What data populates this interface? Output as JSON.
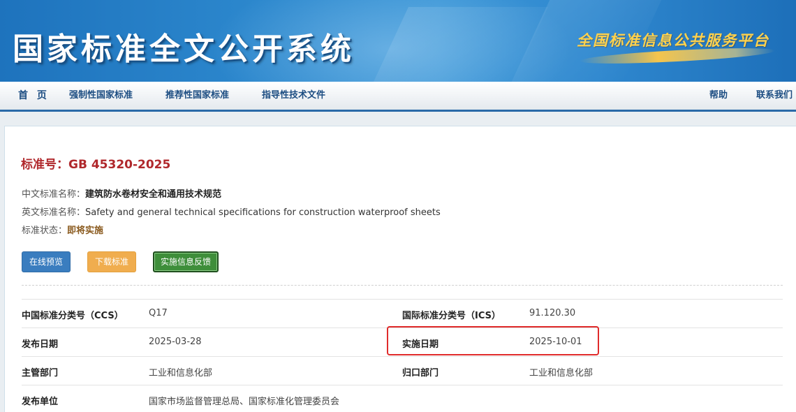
{
  "header": {
    "site_title": "国家标准全文公开系统",
    "slogan": "全国标准信息公共服务平台"
  },
  "nav": {
    "home": "首 页",
    "mandatory": "强制性国家标准",
    "recommended": "推荐性国家标准",
    "guidance": "指导性技术文件",
    "help": "帮助",
    "contact": "联系我们"
  },
  "standard": {
    "number_label": "标准号：",
    "number": "GB 45320-2025",
    "cn_name_label": "中文标准名称：",
    "cn_name": "建筑防水卷材安全和通用技术规范",
    "en_name_label": "英文标准名称：",
    "en_name": "Safety and general technical specifications for construction waterproof sheets",
    "status_label": "标准状态：",
    "status": "即将实施"
  },
  "buttons": {
    "preview": "在线预览",
    "download": "下载标准",
    "feedback": "实施信息反馈"
  },
  "details": {
    "ccs_label": "中国标准分类号（CCS）",
    "ccs_value": "Q17",
    "ics_label": "国际标准分类号（ICS）",
    "ics_value": "91.120.30",
    "publish_date_label": "发布日期",
    "publish_date_value": "2025-03-28",
    "implement_date_label": "实施日期",
    "implement_date_value": "2025-10-01",
    "competent_dept_label": "主管部门",
    "competent_dept_value": "工业和信息化部",
    "centralized_dept_label": "归口部门",
    "centralized_dept_value": "工业和信息化部",
    "issuer_label": "发布单位",
    "issuer_value": "国家市场监督管理总局、国家标准化管理委员会"
  },
  "colors": {
    "banner_blue": "#2b86cc",
    "nav_text": "#1c4d82",
    "standard_red": "#b0282c",
    "preview_blue": "#3a7dbf",
    "download_orange": "#f0ad4e",
    "feedback_green": "#3e8e3a",
    "highlight_red": "#e02b2b"
  }
}
